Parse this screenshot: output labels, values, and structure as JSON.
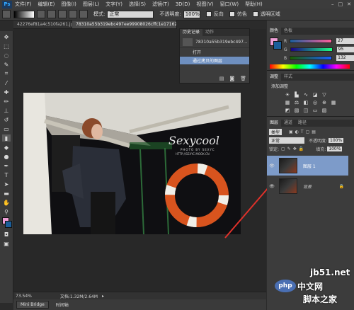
{
  "app": {
    "logo": "Ps"
  },
  "menu": [
    "文件(F)",
    "编辑(E)",
    "图像(I)",
    "图层(L)",
    "文字(Y)",
    "选择(S)",
    "滤镜(T)",
    "3D(D)",
    "视图(V)",
    "窗口(W)",
    "帮助(H)"
  ],
  "options": {
    "mode_label": "模式:",
    "mode_value": "正常",
    "opacity_label": "不透明度:",
    "opacity_value": "100%",
    "reverse_label": "反向",
    "dither_label": "仿色",
    "transparency_label": "透明区域"
  },
  "doc_tabs": [
    {
      "label": "42276ef81a4c510fa261.jpg"
    },
    {
      "label": "78310a55b319ebc497ee99908026cffc1e171620.jpg"
    }
  ],
  "photo": {
    "brand": "Sexycool",
    "subtext": "PHOTO BY SEXYC",
    "url": "HTTP://SEXYC.MOOK.CN"
  },
  "history": {
    "tabs": [
      "历史记录",
      "动作"
    ],
    "snapshot": "78310a55b319ebc497...",
    "items": [
      "打开",
      "通过拷贝的图层"
    ]
  },
  "color_panel": {
    "tabs": [
      "颜色",
      "色板"
    ],
    "r": "27",
    "g": "95",
    "b": "132"
  },
  "adjust_panel": {
    "tabs": [
      "调整",
      "样式"
    ],
    "title": "添加调整"
  },
  "layers_panel": {
    "tabs": [
      "图层",
      "通道",
      "路径"
    ],
    "kind": "类型",
    "blend": "正常",
    "opacity_label": "不透明度:",
    "opacity_value": "100%",
    "lock_label": "锁定:",
    "fill_label": "填充:",
    "fill_value": "100%",
    "layers": [
      {
        "name": "图层 1"
      },
      {
        "name": "背景"
      }
    ]
  },
  "status": {
    "zoom": "73.54%",
    "doc": "文档:1.32M/2.64M"
  },
  "bottom_tabs": [
    "Mini Bridge",
    "时间轴"
  ],
  "watermark": {
    "site": "jb51.net",
    "php": "php",
    "cn": "中文网",
    "slogan": "脚本之家"
  }
}
